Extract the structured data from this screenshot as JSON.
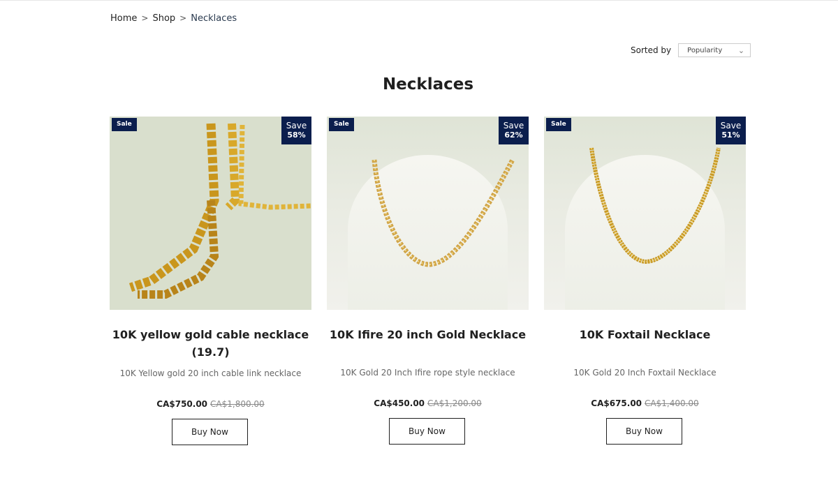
{
  "breadcrumb": {
    "items": [
      "Home",
      "Shop",
      "Necklaces"
    ],
    "separator": ">"
  },
  "sort": {
    "label": "Sorted by",
    "selected": "Popularity"
  },
  "page": {
    "title": "Necklaces"
  },
  "colors": {
    "badge_bg": "#0b1e4d",
    "gold": "#d4a62a"
  },
  "products": [
    {
      "sale_badge": "Sale",
      "save_label": "Save",
      "save_pct": "58%",
      "name": "10K yellow gold cable necklace (19.7)",
      "description": "10K Yellow gold 20 inch cable link necklace",
      "price": "CA$750.00",
      "compare_price": "CA$1,800.00",
      "button": "Buy Now",
      "image_icon": "cable-necklace-photo"
    },
    {
      "sale_badge": "Sale",
      "save_label": "Save",
      "save_pct": "62%",
      "name": "10K Ifire 20 inch Gold Necklace",
      "description": "10K Gold 20 Inch Ifire rope style necklace",
      "price": "CA$450.00",
      "compare_price": "CA$1,200.00",
      "button": "Buy Now",
      "image_icon": "rope-necklace-photo"
    },
    {
      "sale_badge": "Sale",
      "save_label": "Save",
      "save_pct": "51%",
      "name": "10K Foxtail Necklace",
      "description": "10K Gold 20 Inch Foxtail Necklace",
      "price": "CA$675.00",
      "compare_price": "CA$1,400.00",
      "button": "Buy Now",
      "image_icon": "foxtail-necklace-photo"
    }
  ]
}
